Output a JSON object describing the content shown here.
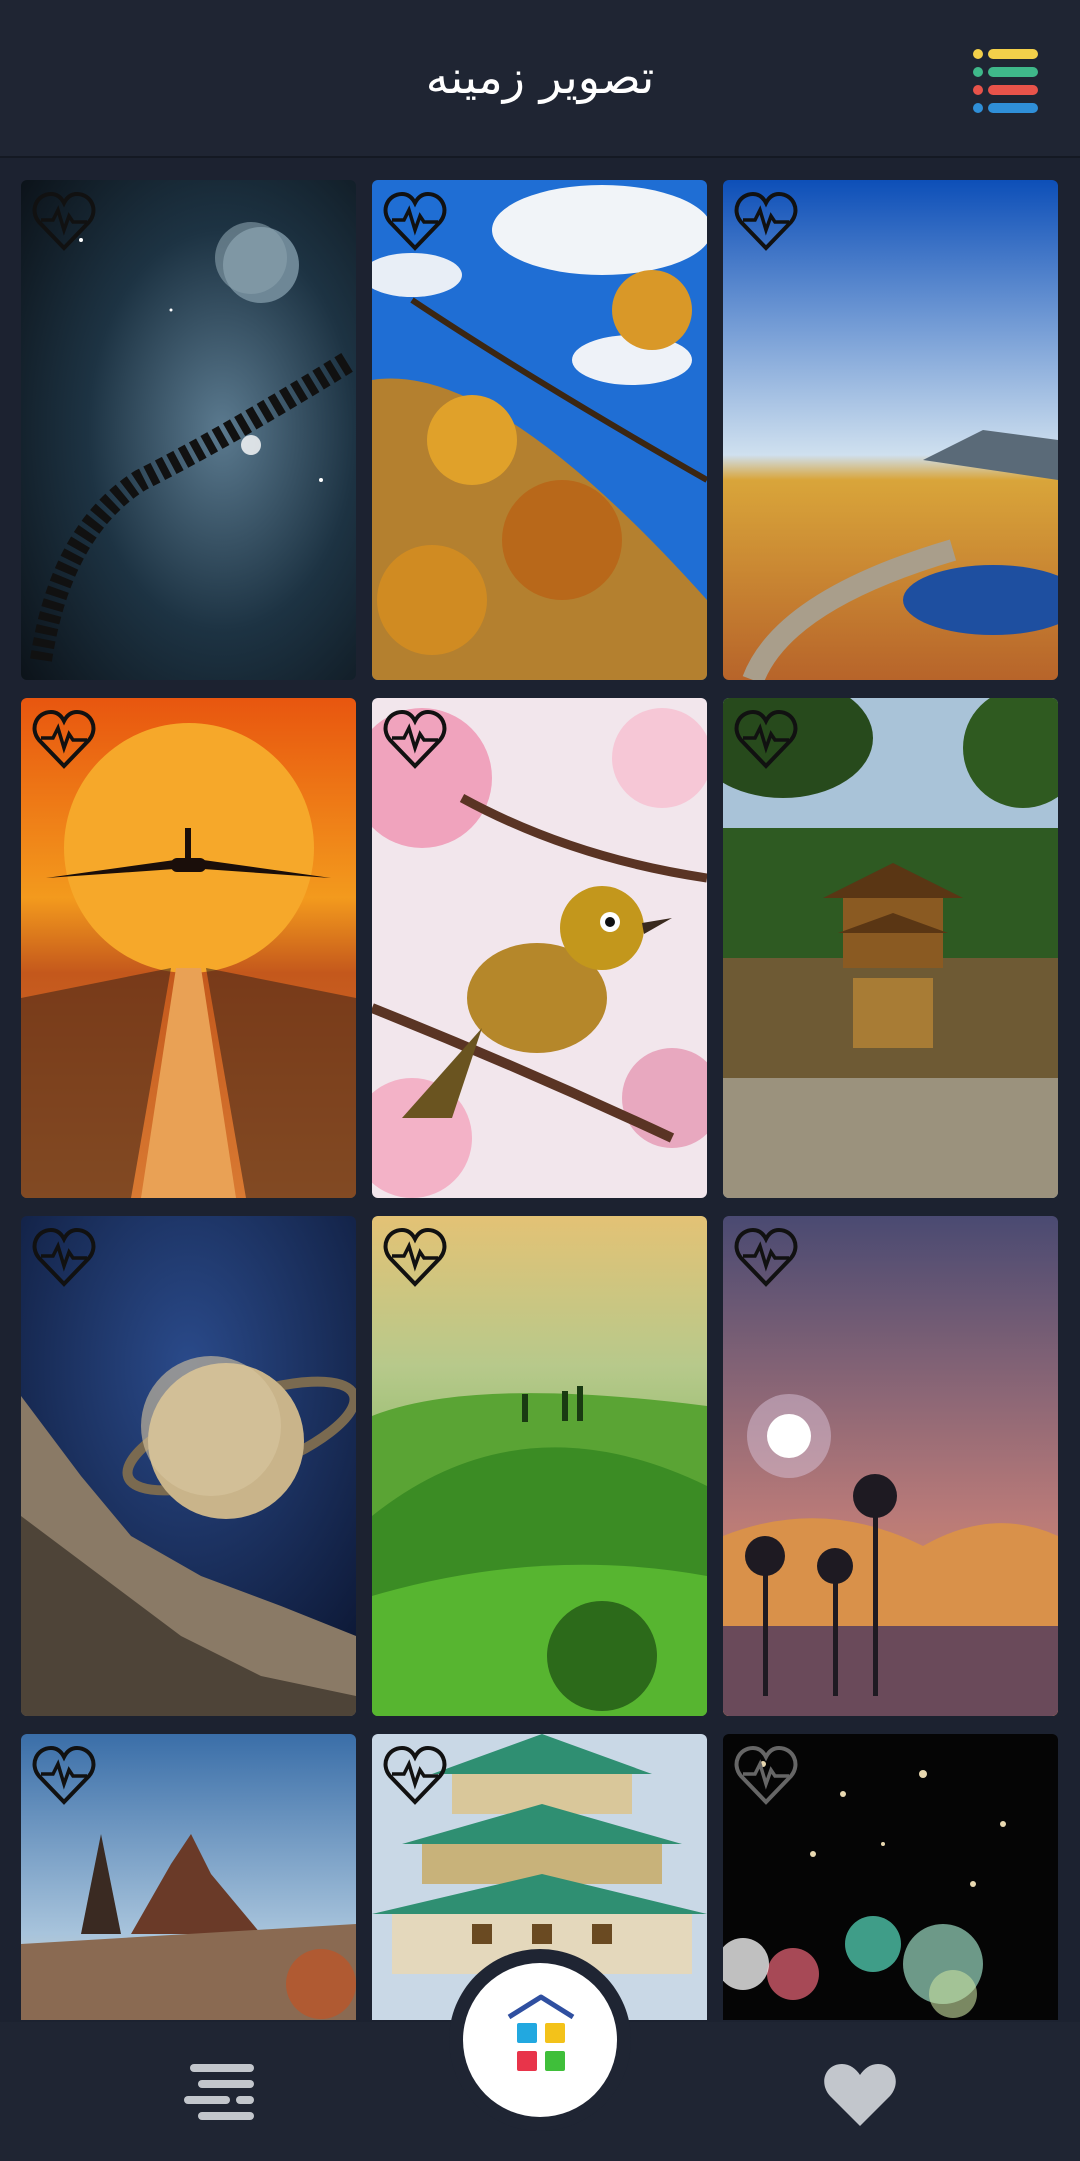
{
  "header": {
    "title": "تصوير زمينه"
  },
  "icons": {
    "menu": "list-menu-icon",
    "favorite": "heart-pulse-icon",
    "nav_menu": "menu-lines-icon",
    "nav_home": "home-apps-icon",
    "nav_favorites": "heart-icon"
  },
  "wallpapers": [
    {
      "name": "space-planet-asteroids"
    },
    {
      "name": "autumn-leaves-blue-sky"
    },
    {
      "name": "boardwalk-lake-mountains"
    },
    {
      "name": "airplane-sunset-pier"
    },
    {
      "name": "bird-cherry-blossom"
    },
    {
      "name": "golden-pavilion-lake"
    },
    {
      "name": "saturn-rocky-cliffs"
    },
    {
      "name": "green-hills-tuscany"
    },
    {
      "name": "moon-palm-trees-sunset"
    },
    {
      "name": "desert-rock-formation"
    },
    {
      "name": "japanese-castle"
    },
    {
      "name": "bokeh-lights-night"
    }
  ],
  "colors": {
    "background": "#1c2230",
    "bar": "#1f2533",
    "accent_yellow": "#f3d04a",
    "accent_green": "#3fb88a",
    "accent_red": "#e8534a",
    "accent_blue": "#2f8fd8"
  }
}
